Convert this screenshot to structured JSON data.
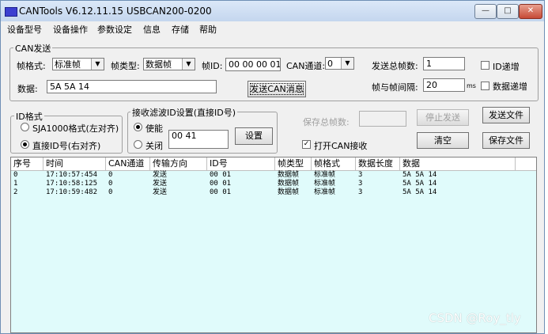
{
  "window": {
    "title": "CANTools V6.12.11.15  USBCAN200-0200",
    "minimize_glyph": "—",
    "maximize_glyph": "□",
    "close_glyph": "✕"
  },
  "menu": [
    "设备型号",
    "设备操作",
    "参数设定",
    "信息",
    "存储",
    "帮助"
  ],
  "can_send": {
    "group_title": "CAN发送",
    "frame_format_label": "帧格式:",
    "frame_format_value": "标准帧",
    "frame_type_label": "帧类型:",
    "frame_type_value": "数据帧",
    "frame_id_label": "帧ID:",
    "frame_id_value": "00 00 00 01",
    "channel_label": "CAN通道:",
    "channel_value": "0",
    "total_frames_label": "发送总帧数:",
    "total_frames_value": "1",
    "id_increment_label": "ID递增",
    "data_label": "数据:",
    "data_value": "5A 5A 14",
    "send_button": "发送CAN消息",
    "interval_label": "帧与帧间隔:",
    "interval_value": "20",
    "interval_unit": "ms",
    "data_increment_label": "数据递增"
  },
  "id_format": {
    "group_title": "ID格式",
    "option_left": "SJA1000格式(左对齐)",
    "option_right": "直接ID号(右对齐)",
    "selected": "option_right"
  },
  "filter": {
    "group_title": "接收滤波ID设置(直接ID号)",
    "enable_label": "使能",
    "disable_label": "关闭",
    "selected": "enable",
    "id_value": "00 41",
    "set_button": "设置"
  },
  "right_panel": {
    "saved_frames_label": "保存总帧数:",
    "stop_send_button": "停止发送",
    "send_file_button": "发送文件",
    "open_receive_label": "打开CAN接收",
    "open_receive_checked": true,
    "clear_button": "清空",
    "save_file_button": "保存文件"
  },
  "table": {
    "columns": [
      "序号",
      "时间",
      "CAN通道",
      "传输方向",
      "ID号",
      "帧类型",
      "帧格式",
      "数据长度",
      "数据"
    ],
    "rows": [
      [
        "0",
        "17:10:57:454",
        "0",
        "发送",
        "00 01",
        "数据帧",
        "标准帧",
        "3",
        "5A 5A 14"
      ],
      [
        "1",
        "17:10:58:125",
        "0",
        "发送",
        "00 01",
        "数据帧",
        "标准帧",
        "3",
        "5A 5A 14"
      ],
      [
        "2",
        "17:10:59:482",
        "0",
        "发送",
        "00 01",
        "数据帧",
        "标准帧",
        "3",
        "5A 5A 14"
      ]
    ]
  },
  "watermark": "CSDN @Roy_tly",
  "colors": {
    "list_background": "#e0fbfb",
    "window_background": "#f0f0f0",
    "app_icon": "#3b3fd0"
  },
  "icons": {
    "app": "can-app-icon",
    "dropdown": "chevron-down-icon"
  }
}
